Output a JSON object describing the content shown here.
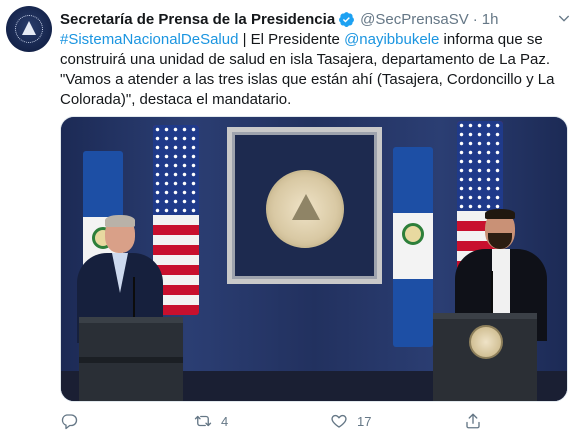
{
  "tweet": {
    "author": {
      "name": "Secretaría de Prensa de la Presidencia",
      "handle": "@SecPrensaSV",
      "verified": true,
      "avatar_icon": "presidential-seal-avatar"
    },
    "separator": "·",
    "time": "1h",
    "text": {
      "hashtag": "#SistemaNacionalDeSalud",
      "part1": " | El Presidente ",
      "mention": "@nayibbukele",
      "part2": " informa que se construirá una unidad de salud en isla Tasajera, departamento de La Paz. \"Vamos a atender a las tres islas que están ahí (Tasajera, Cordoncillo y La Colorada)\", destaca el mandatario."
    },
    "media": {
      "icon": "press-conference-photo"
    },
    "actions": {
      "reply": {
        "icon": "reply-icon",
        "count": ""
      },
      "retweet": {
        "icon": "retweet-icon",
        "count": "4"
      },
      "like": {
        "icon": "heart-icon",
        "count": "17"
      },
      "share": {
        "icon": "share-icon",
        "count": ""
      }
    }
  },
  "colors": {
    "text": "#14171a",
    "secondary": "#657786",
    "link": "#1b95e0",
    "verified": "#1da1f2"
  }
}
